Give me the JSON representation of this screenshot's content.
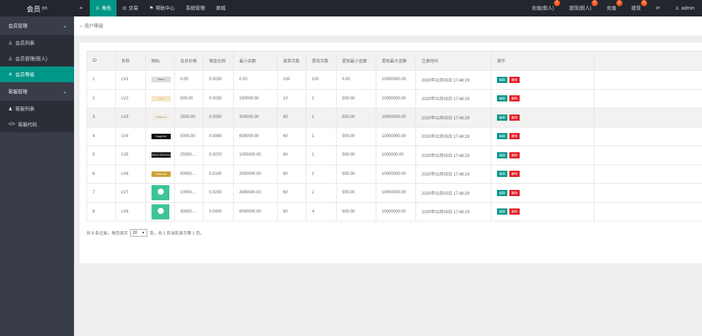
{
  "app": {
    "logo": "会员",
    "logo_sup": "会员"
  },
  "topnav": [
    {
      "icon": "≡",
      "label": ""
    },
    {
      "icon": "♙",
      "label": "角色"
    },
    {
      "icon": "⚖",
      "label": "交易"
    },
    {
      "icon": "⚑",
      "label": "帮助中心"
    },
    {
      "icon": "",
      "label": "系统管理"
    },
    {
      "icon": "",
      "label": "商城"
    }
  ],
  "rightnav": [
    {
      "label": "充值(假人)",
      "badge": "0"
    },
    {
      "label": "提现(假人)",
      "badge": "0"
    },
    {
      "label": "充值",
      "badge": "0"
    },
    {
      "label": "提现",
      "badge": "0"
    },
    {
      "label": "⟳",
      "badge": ""
    },
    {
      "label": "admin",
      "badge": ""
    }
  ],
  "sidebar": {
    "groups": [
      {
        "label": "会员管理",
        "items": [
          {
            "icon": "♙",
            "label": "会员列表"
          },
          {
            "icon": "♙",
            "label": "会员管理(假人)"
          },
          {
            "icon": "⚘",
            "label": "会员等级"
          }
        ]
      },
      {
        "label": "客服管理",
        "items": [
          {
            "icon": "♟",
            "label": "客服列表"
          },
          {
            "icon": "</>",
            "label": "客服代码"
          }
        ]
      }
    ]
  },
  "breadcrumb": {
    "sep": "»",
    "label": "用户等级"
  },
  "table": {
    "headers": [
      "ID",
      "名称",
      "图标",
      "会员价格",
      "佣金比例",
      "最小余额",
      "接单次数",
      "提现次数",
      "提现最小金额",
      "提现最大金额",
      "注册时间",
      "操作"
    ],
    "rows": [
      {
        "id": "1",
        "name": "LV1",
        "icon": "Silver",
        "icon_class": "silver",
        "price": "0.00",
        "rate": "0.0030",
        "min_balance": "0.00",
        "orders": "100",
        "withdraw_times": "100",
        "wd_min": "0.00",
        "wd_max": "10000000.00",
        "time": "2020年02月05日 17:48:29"
      },
      {
        "id": "2",
        "name": "LV2",
        "icon": "Gold",
        "icon_class": "gold",
        "price": "500.00",
        "rate": "0.0035",
        "min_balance": "150000.00",
        "orders": "10",
        "withdraw_times": "1",
        "wd_min": "500.00",
        "wd_max": "10000000.00",
        "time": "2020年02月05日 17:48:29"
      },
      {
        "id": "3",
        "name": "LV3",
        "icon": "Platinum",
        "icon_class": "platinum",
        "price": "2500.00",
        "rate": "0.0050",
        "min_balance": "300000.00",
        "orders": "60",
        "withdraw_times": "1",
        "wd_min": "500.00",
        "wd_max": "10000000.00",
        "time": "2020年02月05日 17:48:29"
      },
      {
        "id": "4",
        "name": "LV4",
        "icon": "Sapphire",
        "icon_class": "sapphire",
        "price": "5000.00",
        "rate": "0.0060",
        "min_balance": "600000.00",
        "orders": "60",
        "withdraw_times": "1",
        "wd_min": "500.00",
        "wd_max": "10000000.00",
        "time": "2020年02月05日 17:48:29"
      },
      {
        "id": "5",
        "name": "LV5",
        "icon": "Black Diamond",
        "icon_class": "black",
        "price": "25000....",
        "rate": "0.0070",
        "min_balance": "1000000.00",
        "orders": "60",
        "withdraw_times": "1",
        "wd_min": "500.00",
        "wd_max": "1000000.00",
        "time": "2020年02月05日 17:48:29"
      },
      {
        "id": "6",
        "name": "LV6",
        "icon": "Diamond",
        "icon_class": "diamond",
        "price": "50000....",
        "rate": "0.0100",
        "min_balance": "2000000.00",
        "orders": "60",
        "withdraw_times": "1",
        "wd_min": "500.00",
        "wd_max": "10000000.00",
        "time": "2020年02月05日 17:48:29"
      },
      {
        "id": "7",
        "name": "LV7",
        "icon": "",
        "icon_class": "pic",
        "price": "10000....",
        "rate": "0.0200",
        "min_balance": "4000000.00",
        "orders": "60",
        "withdraw_times": "2",
        "wd_min": "500.00",
        "wd_max": "10000000.00",
        "time": "2020年02月05日 17:48:29"
      },
      {
        "id": "8",
        "name": "LV8",
        "icon": "",
        "icon_class": "pic",
        "price": "30000....",
        "rate": "0.0400",
        "min_balance": "8000000.00",
        "orders": "60",
        "withdraw_times": "4",
        "wd_min": "500.00",
        "wd_max": "10000000.00",
        "time": "2020年02月05日 17:48:29"
      }
    ],
    "actions": {
      "edit": "编辑",
      "delete": "删除"
    },
    "highlighted_row": 3
  },
  "pager": {
    "prefix": "共 8 条记录，每页显示",
    "page_size": "20",
    "suffix": "条，共 1 页当前显示第 1 页。"
  },
  "colors": {
    "accent": "#009688",
    "danger": "#e51c23",
    "badge": "#ff5722",
    "sidebar": "#393d49",
    "topbar": "#23262e"
  }
}
